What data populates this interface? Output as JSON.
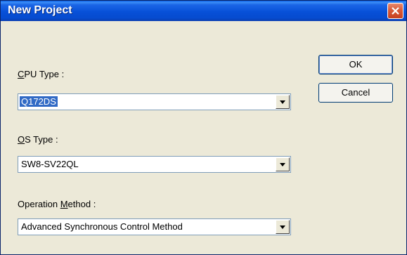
{
  "window": {
    "title": "New Project"
  },
  "fields": {
    "cpu_type": {
      "label_mnemonic": "C",
      "label_rest": "PU Type :",
      "value": "Q172DS"
    },
    "os_type": {
      "label_mnemonic": "O",
      "label_rest": "S Type :",
      "value": "SW8-SV22QL"
    },
    "operation_method": {
      "label_pre": "Operation ",
      "label_mnemonic": "M",
      "label_rest": "ethod :",
      "value": "Advanced Synchronous Control Method"
    }
  },
  "buttons": {
    "ok": "OK",
    "cancel": "Cancel"
  },
  "icons": {
    "close": "close-icon",
    "dropdown": "chevron-down-icon"
  },
  "colors": {
    "title_bar": "#0750d8",
    "close_button": "#d85a39",
    "selection": "#316ac5",
    "dialog_bg": "#ece9d8"
  }
}
